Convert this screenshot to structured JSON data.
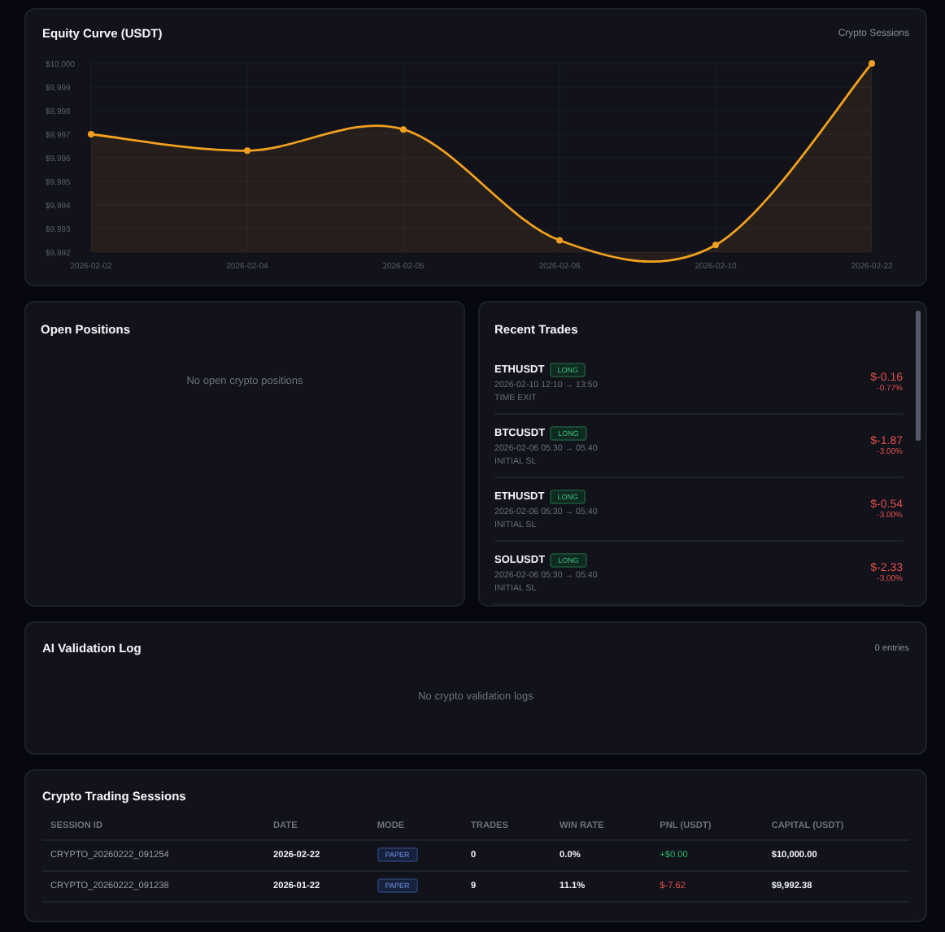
{
  "equity": {
    "title": "Equity Curve (USDT)",
    "link": "Crypto Sessions",
    "chart_data": {
      "type": "area",
      "categories": [
        "2026-02-02",
        "2026-02-04",
        "2026-02-05",
        "2026-02-06",
        "2026-02-10",
        "2026-02-22"
      ],
      "grid": true,
      "series": [
        {
          "color": "#f0a020",
          "values": [
            9997.0,
            9996.3,
            9997.2,
            9992.5,
            9992.3,
            10000.0
          ]
        }
      ],
      "ylim": [
        9992,
        10000
      ],
      "yticks": [
        {
          "value": 9992,
          "label": "$9,992"
        },
        {
          "value": 9993,
          "label": "$9,993"
        },
        {
          "value": 9994,
          "label": "$9,994"
        },
        {
          "value": 9995,
          "label": "$9,995"
        },
        {
          "value": 9996,
          "label": "$9,996"
        },
        {
          "value": 9997,
          "label": "$9,997"
        },
        {
          "value": 9998,
          "label": "$9,998"
        },
        {
          "value": 9999,
          "label": "$9,999"
        },
        {
          "value": 10000,
          "label": "$10,000"
        }
      ]
    }
  },
  "open_positions": {
    "title": "Open Positions",
    "empty": "No open crypto positions"
  },
  "recent_trades": {
    "title": "Recent Trades",
    "items": [
      {
        "symbol": "ETHUSDT",
        "side": "LONG",
        "time": "2026-02-10 12:10 → 13:50",
        "exit": "TIME EXIT",
        "pnl": "$-0.16",
        "pct": "-0.77%",
        "kind": "loss"
      },
      {
        "symbol": "BTCUSDT",
        "side": "LONG",
        "time": "2026-02-06 05:30 → 05:40",
        "exit": "INITIAL SL",
        "pnl": "$-1.87",
        "pct": "-3.00%",
        "kind": "loss"
      },
      {
        "symbol": "ETHUSDT",
        "side": "LONG",
        "time": "2026-02-06 05:30 → 05:40",
        "exit": "INITIAL SL",
        "pnl": "$-0.54",
        "pct": "-3.00%",
        "kind": "loss"
      },
      {
        "symbol": "SOLUSDT",
        "side": "LONG",
        "time": "2026-02-06 05:30 → 05:40",
        "exit": "INITIAL SL",
        "pnl": "$-2.33",
        "pct": "-3.00%",
        "kind": "loss"
      }
    ]
  },
  "validation_log": {
    "title": "AI Validation Log",
    "count": "0 entries",
    "empty": "No crypto validation logs"
  },
  "sessions": {
    "title": "Crypto Trading Sessions",
    "columns": [
      "SESSION ID",
      "DATE",
      "MODE",
      "TRADES",
      "WIN RATE",
      "PNL (USDT)",
      "CAPITAL (USDT)"
    ],
    "rows": [
      {
        "id": "CRYPTO_20260222_091254",
        "date": "2026-02-22",
        "mode": "PAPER",
        "trades": "0",
        "win_rate": "0.0%",
        "pnl": "+$0.00",
        "kind": "gain",
        "capital": "$10,000.00"
      },
      {
        "id": "CRYPTO_20260222_091238",
        "date": "2026-01-22",
        "mode": "PAPER",
        "trades": "9",
        "win_rate": "11.1%",
        "pnl": "$-7.62",
        "kind": "loss",
        "capital": "$9,992.38"
      }
    ]
  }
}
